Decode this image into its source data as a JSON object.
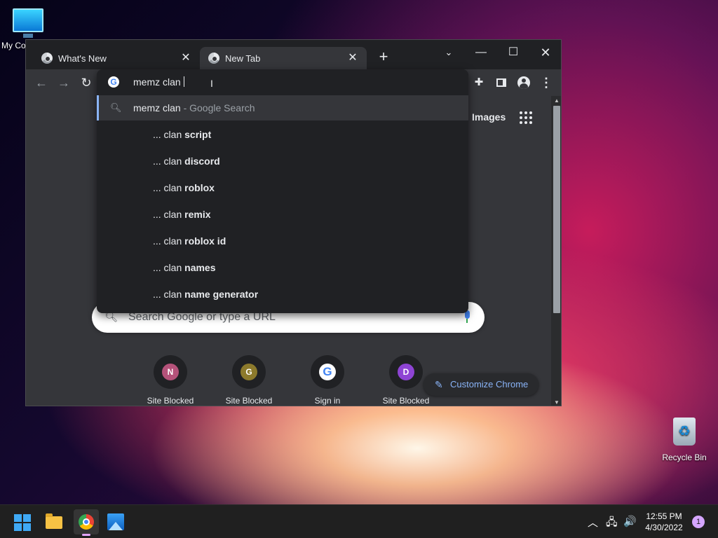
{
  "desktop": {
    "icons": [
      {
        "label": "My Co",
        "icon": "computer-icon"
      },
      {
        "label": "Recycle Bin",
        "icon": "recycle-bin-icon"
      }
    ]
  },
  "browser": {
    "tabs": [
      {
        "title": "What's New",
        "icon": "chrome-favicon-icon",
        "close": "✕"
      },
      {
        "title": "New Tab",
        "icon": "chrome-favicon-icon",
        "close": "✕"
      }
    ],
    "new_tab_glyph": "+",
    "window_controls": {
      "tab_search": "⌄",
      "minimize": "—",
      "maximize": "☐",
      "close": "✕"
    },
    "toolbar": {
      "back": "←",
      "forward": "→",
      "reload": "↻",
      "extensions": "✚",
      "menu": "⋮"
    },
    "omnibox": {
      "value": "memz clan",
      "selected_suggestion": {
        "query": "memz clan",
        "suffix": "- Google Search"
      },
      "suggestions": [
        {
          "prefix": "... clan",
          "bold": "script"
        },
        {
          "prefix": "... clan",
          "bold": "discord"
        },
        {
          "prefix": "... clan",
          "bold": "roblox"
        },
        {
          "prefix": "... clan",
          "bold": "remix"
        },
        {
          "prefix": "... clan",
          "bold": "roblox id"
        },
        {
          "prefix": "... clan",
          "bold": "names"
        },
        {
          "prefix": "... clan",
          "bold": "name generator"
        }
      ]
    },
    "ntp": {
      "images_link": "Images",
      "search_placeholder": "Search Google or type a URL",
      "shortcuts": [
        {
          "letter": "N",
          "label": "Site Blocked",
          "color": "#b5527a"
        },
        {
          "letter": "G",
          "label": "Site Blocked",
          "color": "#8c7a2c"
        },
        {
          "letter": "",
          "label": "Sign in",
          "color": "#ffffff"
        },
        {
          "letter": "D",
          "label": "Site Blocked",
          "color": "#8e44d4"
        }
      ],
      "customize_label": "Customize Chrome"
    }
  },
  "taskbar": {
    "apps": [
      "start-icon",
      "file-explorer-icon",
      "chrome-icon",
      "photos-icon"
    ],
    "tray": {
      "chevron": "︿",
      "network": "🖧",
      "volume": "🔊"
    },
    "clock": {
      "time": "12:55 PM",
      "date": "4/30/2022"
    },
    "notifications": "1"
  }
}
